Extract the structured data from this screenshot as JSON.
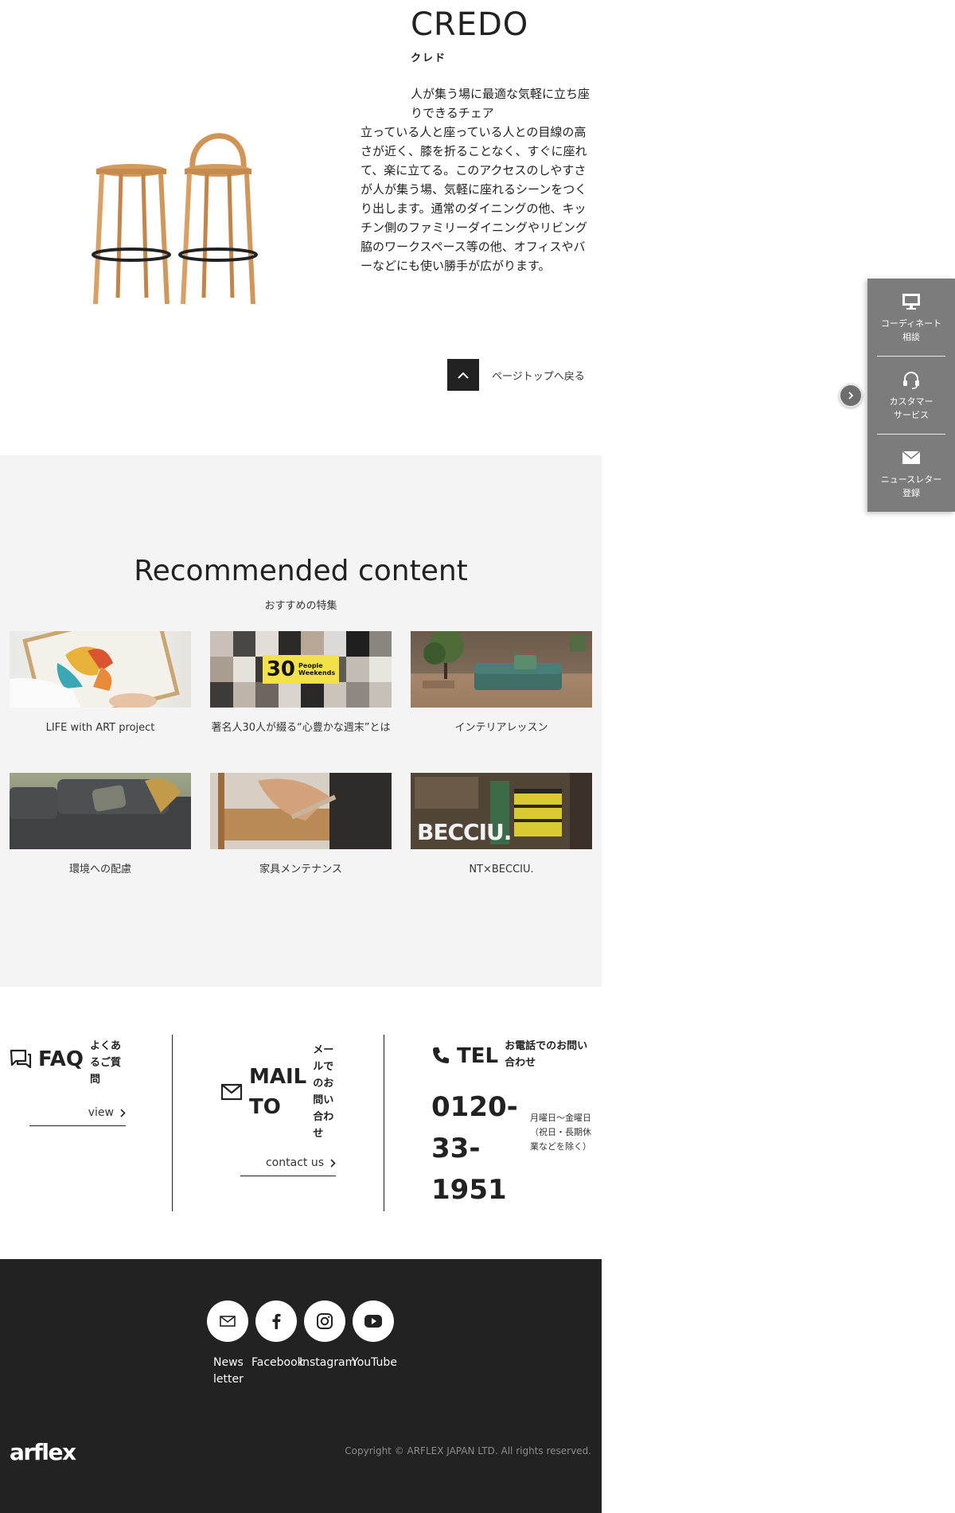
{
  "product": {
    "title": "CREDO",
    "kana": "クレド",
    "lead": "人が集う場に最適な気軽に立ち座りできるチェア",
    "body": "立っている人と座っている人との目線の高さが近く、膝を折ることなく、すぐに座れて、楽に立てる。このアクセスのしやすさが人が集う場、気軽に座れるシーンをつくり出します。通常のダイニングの他、キッチン側のファミリーダイニングやリビング脇のワークスペース等の他、オフィスやバーなどにも使い勝手が広がります。",
    "back_to_top": "ページトップへ戻る"
  },
  "side_panel": {
    "items": [
      {
        "label1": "コーディネート",
        "label2": "相談",
        "icon": "monitor-icon"
      },
      {
        "label1": "カスタマー",
        "label2": "サービス",
        "icon": "headset-icon"
      },
      {
        "label1": "ニュースレター",
        "label2": "登録",
        "icon": "envelope-icon"
      }
    ]
  },
  "recommended": {
    "title": "Recommended content",
    "subtitle": "おすすめの特集",
    "cards": [
      {
        "caption": "LIFE with ART project"
      },
      {
        "caption": "著名人30人が綴る“心豊かな週末”とは",
        "badge_num": "30",
        "badge_text1": "People",
        "badge_text2": "Weekends"
      },
      {
        "caption": "インテリアレッスン"
      },
      {
        "caption": "環境への配慮"
      },
      {
        "caption": "家具メンテナンス"
      },
      {
        "caption": "NT×BECCIU.",
        "overlay": "BECCIU."
      }
    ]
  },
  "contact": {
    "faq": {
      "title": "FAQ",
      "desc1": "よくあ",
      "desc2": "るご質",
      "desc3": "問",
      "link": "view"
    },
    "mail": {
      "title1": "MAIL",
      "title2": "TO",
      "desc": [
        "メー",
        "ルで",
        "のお",
        "問い",
        "合わ",
        "せ"
      ],
      "link": "contact us"
    },
    "tel": {
      "title": "TEL",
      "desc1": "お電話でのお問い",
      "desc2": "合わせ",
      "num1": "0120-",
      "num2": "33-",
      "num3": "1951",
      "note": "月曜日〜金曜日　（祝日・長期休業などを除く）"
    }
  },
  "footer": {
    "social": [
      {
        "label": "News letter",
        "icon": "mail-icon"
      },
      {
        "label": "Facebook",
        "icon": "facebook-icon"
      },
      {
        "label": "Instagram",
        "icon": "instagram-icon"
      },
      {
        "label": "YouTube",
        "icon": "youtube-icon"
      }
    ],
    "logo": "arflex",
    "copyright": "Copyright © ARFLEX JAPAN LTD. All rights reserved."
  }
}
